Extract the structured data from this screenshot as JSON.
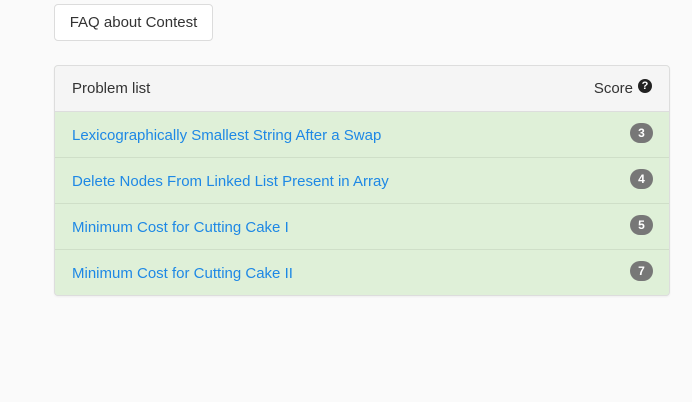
{
  "faq_button": {
    "label": "FAQ about Contest"
  },
  "panel": {
    "header_title": "Problem list",
    "header_score": "Score",
    "help_icon_glyph": "?",
    "help_icon": "question-circle-icon",
    "row_background": "#dff0d8",
    "link_color": "#1e88e5",
    "badge_color": "#777777",
    "problems": [
      {
        "title": "Lexicographically Smallest String After a Swap",
        "score": "3"
      },
      {
        "title": "Delete Nodes From Linked List Present in Array",
        "score": "4"
      },
      {
        "title": "Minimum Cost for Cutting Cake I",
        "score": "5"
      },
      {
        "title": "Minimum Cost for Cutting Cake II",
        "score": "7"
      }
    ]
  }
}
